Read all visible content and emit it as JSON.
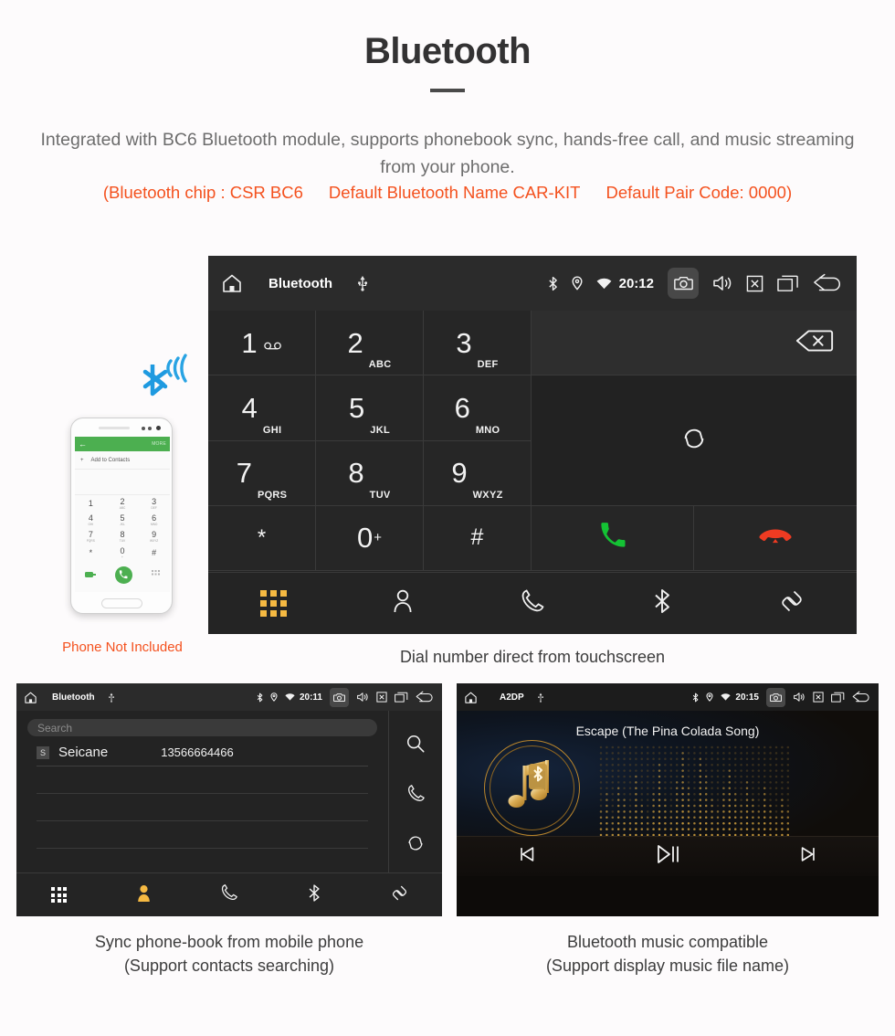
{
  "header": {
    "title": "Bluetooth",
    "description": "Integrated with BC6 Bluetooth module, supports phonebook sync, hands-free call, and music streaming from your phone.",
    "spec_chip": "(Bluetooth chip : CSR BC6",
    "spec_name": "Default Bluetooth Name CAR-KIT",
    "spec_pair": "Default Pair Code: 0000)",
    "accent_color": "#f4511e",
    "text_color": "#6d6d6d"
  },
  "phone_mockup": {
    "caption": "Phone Not Included",
    "screen_header_back": "←",
    "screen_header_more": "MORE",
    "add_contact_label": "Add to Contacts",
    "keys": [
      {
        "digit": "1",
        "letters": ""
      },
      {
        "digit": "2",
        "letters": "ABC"
      },
      {
        "digit": "3",
        "letters": "DEF"
      },
      {
        "digit": "4",
        "letters": "GHI"
      },
      {
        "digit": "5",
        "letters": "JKL"
      },
      {
        "digit": "6",
        "letters": "MNO"
      },
      {
        "digit": "7",
        "letters": "PQRS"
      },
      {
        "digit": "8",
        "letters": "TUV"
      },
      {
        "digit": "9",
        "letters": "WXYZ"
      },
      {
        "digit": "*",
        "letters": ""
      },
      {
        "digit": "0",
        "letters": "+"
      },
      {
        "digit": "#",
        "letters": ""
      }
    ]
  },
  "dialer": {
    "caption": "Dial number direct from touchscreen",
    "statusbar": {
      "home_icon": "home-icon",
      "title": "Bluetooth",
      "usb_icon": "usb-icon",
      "bluetooth_icon": "bluetooth-icon",
      "location_icon": "location-icon",
      "wifi_icon": "wifi-icon",
      "time": "20:12",
      "camera_icon": "camera-icon",
      "volume_icon": "volume-icon",
      "close_icon": "close-box-icon",
      "recents_icon": "recents-icon",
      "back_icon": "back-icon"
    },
    "keys": [
      {
        "digit": "1",
        "letters": "",
        "voicemail": true
      },
      {
        "digit": "2",
        "letters": "ABC"
      },
      {
        "digit": "3",
        "letters": "DEF"
      },
      {
        "digit": "4",
        "letters": "GHI"
      },
      {
        "digit": "5",
        "letters": "JKL"
      },
      {
        "digit": "6",
        "letters": "MNO"
      },
      {
        "digit": "7",
        "letters": "PQRS"
      },
      {
        "digit": "8",
        "letters": "TUV"
      },
      {
        "digit": "9",
        "letters": "WXYZ"
      },
      {
        "digit": "*",
        "letters": ""
      },
      {
        "digit": "0",
        "letters": "+"
      },
      {
        "digit": "#",
        "letters": ""
      }
    ],
    "backspace_icon": "backspace-icon",
    "sync_icon": "sync-icon",
    "call_icon": "call-icon",
    "hangup_icon": "hangup-icon",
    "call_color": "#14c234",
    "hangup_color": "#ee3b22",
    "navbar": [
      {
        "name": "keypad",
        "icon": "keypad-icon",
        "active": true
      },
      {
        "name": "contacts",
        "icon": "contact-icon",
        "active": false
      },
      {
        "name": "call-log",
        "icon": "handset-icon",
        "active": false
      },
      {
        "name": "bluetooth",
        "icon": "bluetooth-icon",
        "active": false
      },
      {
        "name": "link",
        "icon": "link-icon",
        "active": false
      }
    ],
    "active_color": "#f5b942"
  },
  "phonebook": {
    "caption_line1": "Sync phone-book from mobile phone",
    "caption_line2": "(Support contacts searching)",
    "statusbar": {
      "title": "Bluetooth",
      "time": "20:11"
    },
    "search_placeholder": "Search",
    "contacts": [
      {
        "initial": "S",
        "name": "Seicane",
        "number": "13566664466"
      }
    ],
    "side_actions": [
      {
        "name": "search",
        "icon": "search-icon"
      },
      {
        "name": "call",
        "icon": "handset-icon"
      },
      {
        "name": "sync",
        "icon": "sync-icon"
      }
    ],
    "navbar": [
      {
        "name": "keypad",
        "icon": "keypad-icon",
        "active": false
      },
      {
        "name": "contacts",
        "icon": "contact-filled-icon",
        "active": true
      },
      {
        "name": "call-log",
        "icon": "handset-icon",
        "active": false
      },
      {
        "name": "bluetooth",
        "icon": "bluetooth-icon",
        "active": false
      },
      {
        "name": "link",
        "icon": "link-icon",
        "active": false
      }
    ]
  },
  "music": {
    "caption_line1": "Bluetooth music compatible",
    "caption_line2": "(Support display music file name)",
    "statusbar": {
      "title": "A2DP",
      "time": "20:15"
    },
    "song_title": "Escape (The Pina Colada Song)",
    "album_icon": "music-note-bluetooth-icon",
    "accent_color": "#d4a144",
    "controls": [
      {
        "name": "previous",
        "icon": "skip-previous-icon"
      },
      {
        "name": "play-pause",
        "icon": "play-pause-icon"
      },
      {
        "name": "next",
        "icon": "skip-next-icon"
      }
    ]
  }
}
